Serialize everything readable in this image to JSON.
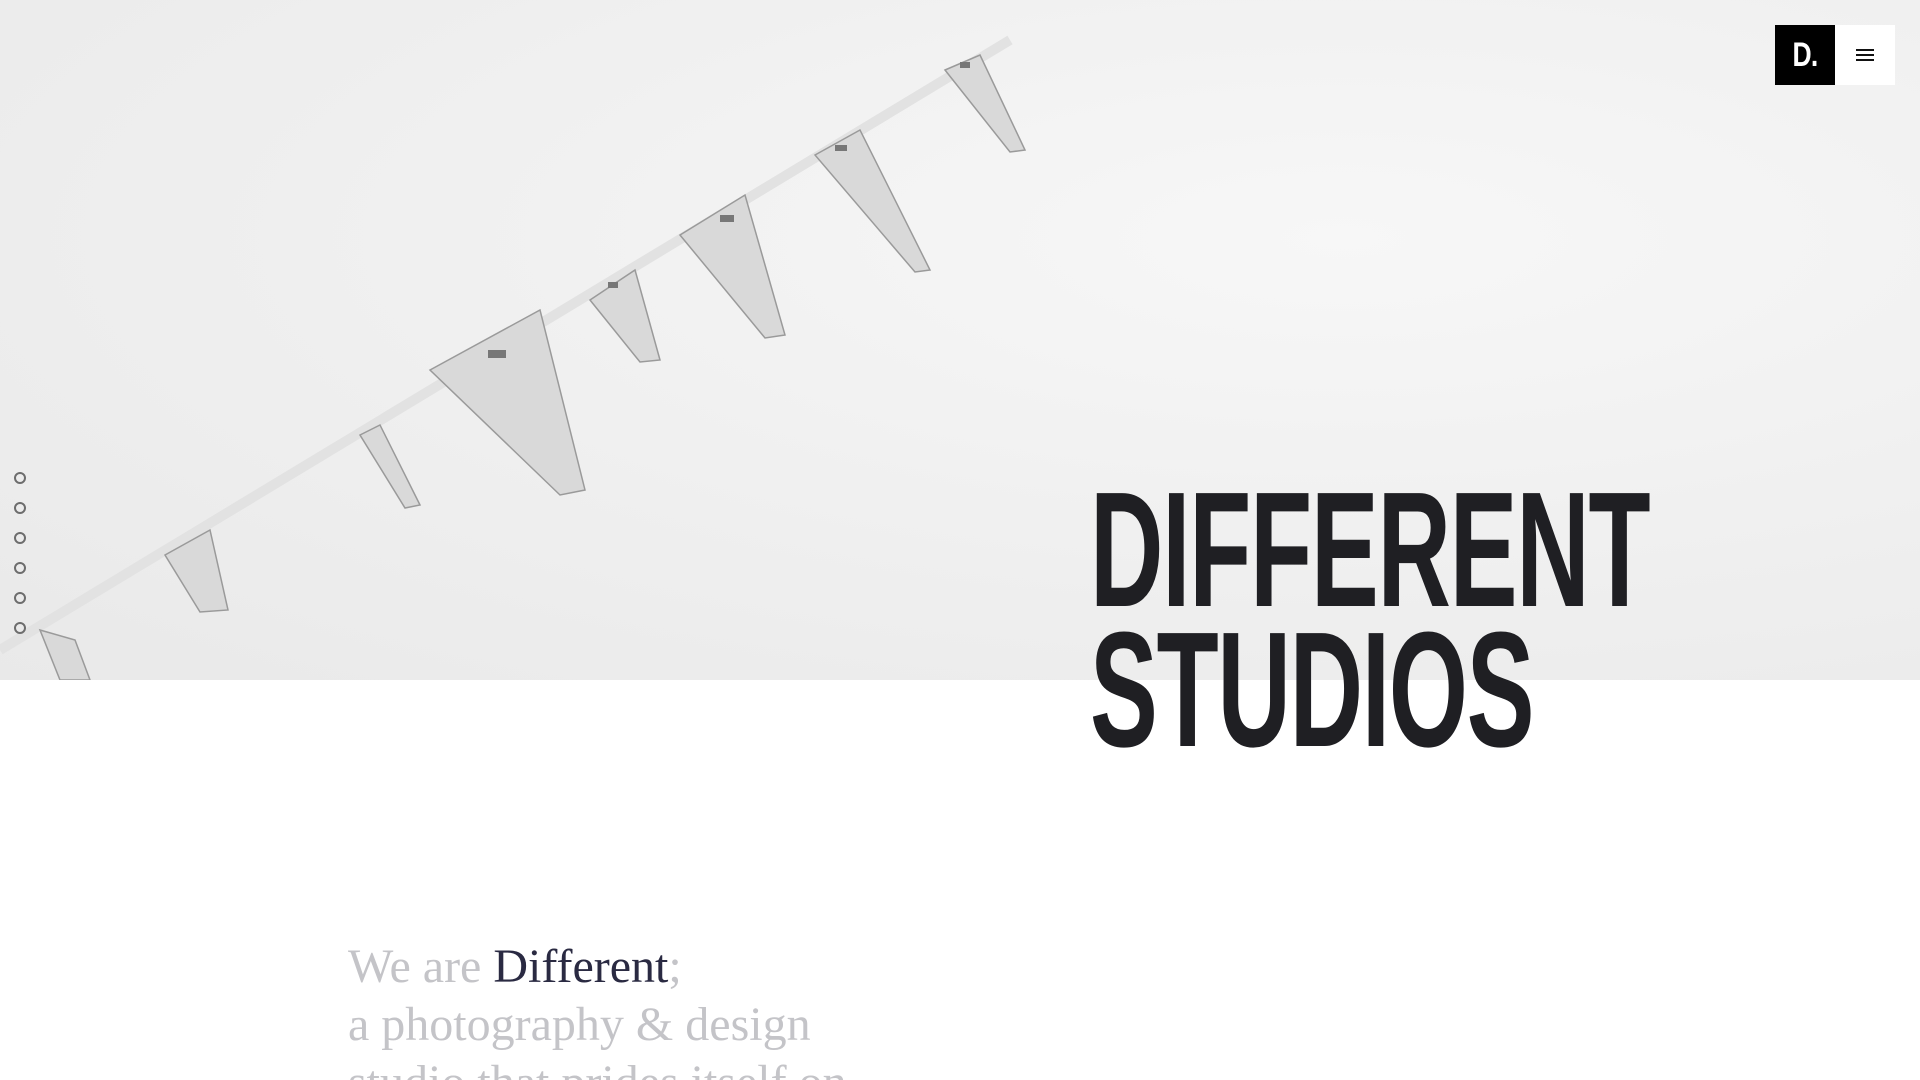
{
  "brand": {
    "logo_text": "D.",
    "menu_icon": "hamburger-icon"
  },
  "side_nav": {
    "dots": [
      "dot-1",
      "dot-2",
      "dot-3",
      "dot-4",
      "dot-5",
      "dot-6"
    ]
  },
  "hero": {
    "title_line1": "DIFFERENT",
    "title_line2": "STUDIOS",
    "background_color": "#efefef",
    "title_color": "#1f1f23"
  },
  "intro": {
    "prefix": "We are ",
    "highlight": "Different",
    "suffix": ";",
    "line2": "a photography & design",
    "line3": "studio that prides itself on",
    "text_color": "#c4c4c8",
    "highlight_color": "#2a2a42"
  }
}
